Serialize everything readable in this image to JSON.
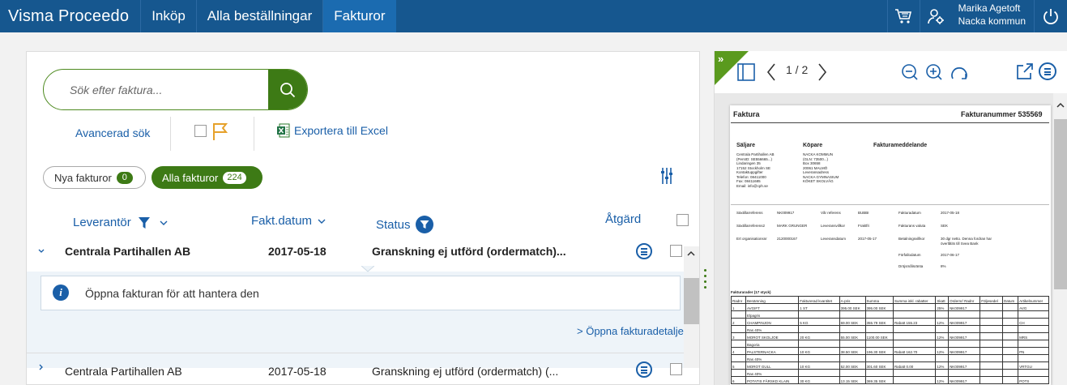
{
  "header": {
    "brand": "Visma Proceedo",
    "nav": [
      "Inköp",
      "Alla beställningar",
      "Fakturor"
    ],
    "active_nav": "Fakturor",
    "user_name": "Marika Agetoft",
    "user_org": "Nacka kommun"
  },
  "search": {
    "placeholder": "Sök efter faktura..."
  },
  "tools": {
    "advanced_search": "Avancerad sök",
    "export_excel": "Exportera till Excel"
  },
  "filters": {
    "new_label": "Nya fakturor",
    "new_count": "0",
    "all_label": "Alla fakturor",
    "all_count": "224"
  },
  "columns": {
    "supplier": "Leverantör",
    "date": "Fakt.datum",
    "status": "Status",
    "action": "Åtgärd"
  },
  "rows": [
    {
      "supplier": "Centrala Partihallen AB",
      "date": "2017-05-18",
      "status": "Granskning ej utförd (ordermatch)..."
    },
    {
      "supplier": "Centrala Partihallen AB",
      "date": "2017-05-18",
      "status": "Granskning ej utförd (ordermatch) (..."
    }
  ],
  "expanded": {
    "info": "Öppna fakturan för att hantera den",
    "open_details": "> Öppna fakturadetaljer"
  },
  "viewer": {
    "page": "1 / 2",
    "doc": {
      "title": "Faktura",
      "number": "Fakturanummer 535569",
      "seller_h": "Säljare",
      "buyer_h": "Köpare",
      "message_h": "Fakturameddelande",
      "seller_lines": [
        "Centrala Partihallen AB",
        "(PersID: SE556665...)",
        "Lindaringen 35",
        "17152 Stockholm SE",
        "Kontaktuppgifter",
        "Telefon: 08411000",
        "Fax: 08411685",
        "Email: info@cph.se"
      ],
      "buyer_lines": [
        "NACKA KOMMUN",
        "(GLN: 73500...)",
        "Box 30658",
        "20061 MALMÖ",
        "Leveransadress",
        "NACKA GYMNASIUM",
        "KÖKET SKOLVÄG"
      ],
      "ref_rows": [
        [
          "Säxtillarreferens",
          "NK009917",
          "Vår referens",
          "BUBBI",
          "Fakturadatum",
          "2017-05-18"
        ],
        [
          "Säxtillarreferens2",
          "MARK GRUNGER",
          "Leveransvillkor",
          "Fraktfri",
          "Fakturans valuta",
          "SEK"
        ],
        [
          "Ert organisationsnr",
          "2120000167",
          "Leveransdatum",
          "2017-05-17",
          "Betalningsvillkor",
          "30 dgr netto. Denna fordran har överlåtits till Svea Bank"
        ],
        [
          "",
          "",
          "",
          "",
          "Förfallodatum",
          "2017-06-17"
        ],
        [
          "",
          "",
          "",
          "",
          "Dröjsmålsränta",
          "8%"
        ]
      ],
      "table_caption": "Fakturarader (17 styck)",
      "table_head": [
        "Radnr",
        "Benämning",
        "Fakturerad kvantitet",
        "A-pris",
        "Summa",
        "Summa inkl. rabatter",
        "Skatt",
        "Ordernr/ Radnr",
        "Följesedel",
        "Datum",
        "Artikelnummer"
      ],
      "table_rows": [
        [
          "1",
          "AVGIFT",
          "1 ST",
          "395.00 SEK",
          "395.00 SEK",
          "",
          "25%",
          "NK009917",
          "",
          "",
          "AVG"
        ],
        [
          "",
          "Elpagris",
          "",
          "",
          "",
          "",
          "",
          "",
          "",
          "",
          ""
        ],
        [
          "2",
          "CHAMPINJON",
          "5 KG",
          "69.00 SEK",
          "355.79 SEK",
          "Rabatt 155.23",
          "12%",
          "NK009917",
          "",
          "",
          "CH"
        ],
        [
          "",
          "Ras 40%",
          "",
          "",
          "",
          "",
          "",
          "",
          "",
          "",
          ""
        ],
        [
          "3",
          "MOROT SKOLJOE",
          "20 KG",
          "55.00 SEK",
          "1100.00 SEK",
          "",
          "12%",
          "NK009917",
          "",
          "",
          "MRS"
        ],
        [
          "",
          "Bagoria",
          "",
          "",
          "",
          "",
          "",
          "",
          "",
          "",
          ""
        ],
        [
          "4",
          "PALSTERNACKA",
          "10 KG",
          "38.50 SEK",
          "196.30 SEK",
          "Rabatt 162.70",
          "12%",
          "NK009917",
          "",
          "",
          "PN"
        ],
        [
          "",
          "Ras 40%",
          "",
          "",
          "",
          "",
          "",
          "",
          "",
          "",
          ""
        ],
        [
          "5",
          "MOROT GULL",
          "10 KG",
          "52.00 SEK",
          "301.60 SEK",
          "Rabatt 0.00",
          "12%",
          "NK009917",
          "",
          "",
          "VRTGU"
        ],
        [
          "",
          "Ras 40%",
          "",
          "",
          "",
          "",
          "",
          "",
          "",
          "",
          ""
        ],
        [
          "6",
          "POTATIS FÄRSKD KLAIN",
          "30 KG",
          "13.15 SEK",
          "369.35 SEK",
          "",
          "12%",
          "NK009917",
          "",
          "",
          "POTS"
        ]
      ]
    }
  },
  "colors": {
    "topbar": "#16578f",
    "accent_green": "#3d7a15",
    "link_blue": "#1a5fa8"
  }
}
